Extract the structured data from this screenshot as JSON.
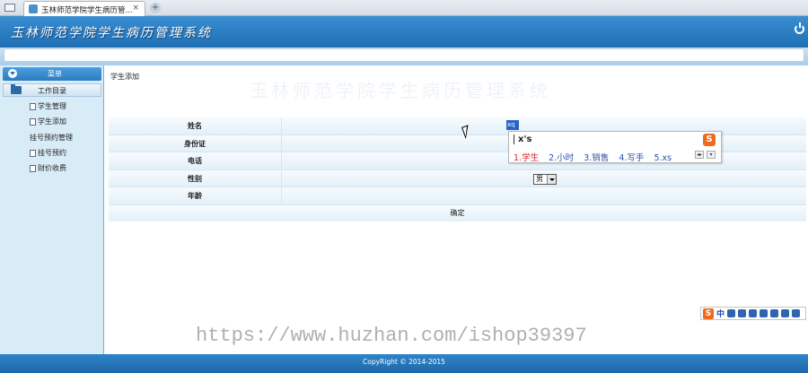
{
  "browser": {
    "tab_title": "玉林师范学院学生病历管...",
    "close_glyph": "×",
    "new_tab_glyph": "+"
  },
  "header": {
    "title": "玉林师范学院学生病历管理系统"
  },
  "sidebar": {
    "menu_label": "菜单",
    "group_label": "工作目录",
    "items": [
      {
        "label": "学生管理",
        "icon": "doc-icon"
      },
      {
        "label": "学生添加",
        "icon": "doc-icon"
      },
      {
        "label": "挂号预约管理",
        "icon": ""
      },
      {
        "label": "挂号预约",
        "icon": "doc-icon"
      },
      {
        "label": "财价收费",
        "icon": "doc-icon"
      }
    ]
  },
  "main": {
    "breadcrumb": "学生添加",
    "ghost_text": "玉林师范学院学生病历管理系统",
    "form": {
      "fields": [
        {
          "label": "姓名",
          "value": "xq"
        },
        {
          "label": "身份证",
          "value": ""
        },
        {
          "label": "电话",
          "value": ""
        },
        {
          "label": "性别",
          "value": "男"
        },
        {
          "label": "年龄",
          "value": ""
        }
      ],
      "submit_label": "确定"
    }
  },
  "ime": {
    "input": "x's",
    "logo": "S",
    "candidates": [
      "1.学生",
      "2.小时",
      "3.销售",
      "4.写手",
      "5.xs"
    ],
    "status_zh": "中"
  },
  "watermark": "https://www.huzhan.com/ishop39397",
  "footer": {
    "copyright": "CopyRight © 2014-2015"
  },
  "colors": {
    "header": "#2a7cc2",
    "sidebar": "#d8ecf8",
    "candidate_highlight": "#d8262b"
  }
}
